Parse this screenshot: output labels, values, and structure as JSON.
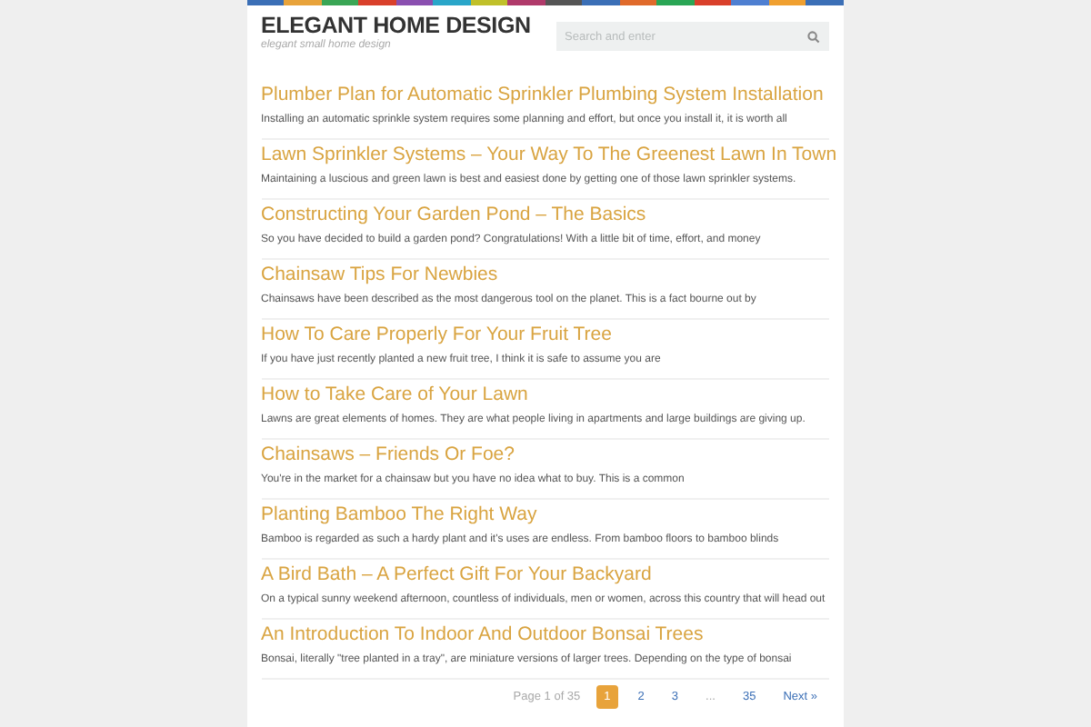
{
  "header": {
    "site_title": "ELEGANT HOME DESIGN",
    "tagline": "elegant small home design",
    "search": {
      "placeholder": "Search and enter"
    }
  },
  "posts": [
    {
      "title": "Plumber Plan for Automatic Sprinkler Plumbing System Installation",
      "excerpt": "Installing an automatic sprinkle system requires some planning and effort, but once you install it, it is worth all"
    },
    {
      "title": "Lawn Sprinkler Systems – Your Way To The Greenest Lawn In Town",
      "excerpt": "Maintaining a luscious and green lawn is best and easiest done by getting one of those lawn sprinkler systems."
    },
    {
      "title": "Constructing Your Garden Pond – The Basics",
      "excerpt": "So you have decided to build a garden pond? Congratulations! With a little bit of time, effort, and money"
    },
    {
      "title": "Chainsaw Tips For Newbies",
      "excerpt": "Chainsaws have been described as the most dangerous tool on the planet. This is a fact bourne out by"
    },
    {
      "title": "How To Care Properly For Your Fruit Tree",
      "excerpt": "If you have just recently planted a new fruit tree, I think it is safe to assume you are"
    },
    {
      "title": "How to Take Care of Your Lawn",
      "excerpt": "Lawns are great elements of homes. They are what people living in apartments and large buildings are giving up."
    },
    {
      "title": "Chainsaws – Friends Or Foe?",
      "excerpt": "You're in the market for a chainsaw but you have no idea what to buy. This is a common"
    },
    {
      "title": "Planting Bamboo The Right Way",
      "excerpt": "Bamboo is regarded as such a hardy plant and it's uses are endless. From bamboo floors to bamboo blinds"
    },
    {
      "title": "A Bird Bath – A Perfect Gift For Your Backyard",
      "excerpt": "On a typical sunny weekend afternoon, countless of individuals, men or women, across this country that will head out"
    },
    {
      "title": "An Introduction To Indoor And Outdoor Bonsai Trees",
      "excerpt": "Bonsai, literally \"tree planted in a tray\", are miniature versions of larger trees. Depending on the type of bonsai"
    }
  ],
  "pagination": {
    "summary": "Page 1 of 35",
    "pages": [
      {
        "label": "1",
        "kind": "page",
        "selected": true
      },
      {
        "label": "2",
        "kind": "page",
        "selected": false
      },
      {
        "label": "3",
        "kind": "page",
        "selected": false
      },
      {
        "label": "...",
        "kind": "gap"
      },
      {
        "label": "35",
        "kind": "page",
        "selected": false
      },
      {
        "label": "Next »",
        "kind": "next"
      }
    ]
  }
}
